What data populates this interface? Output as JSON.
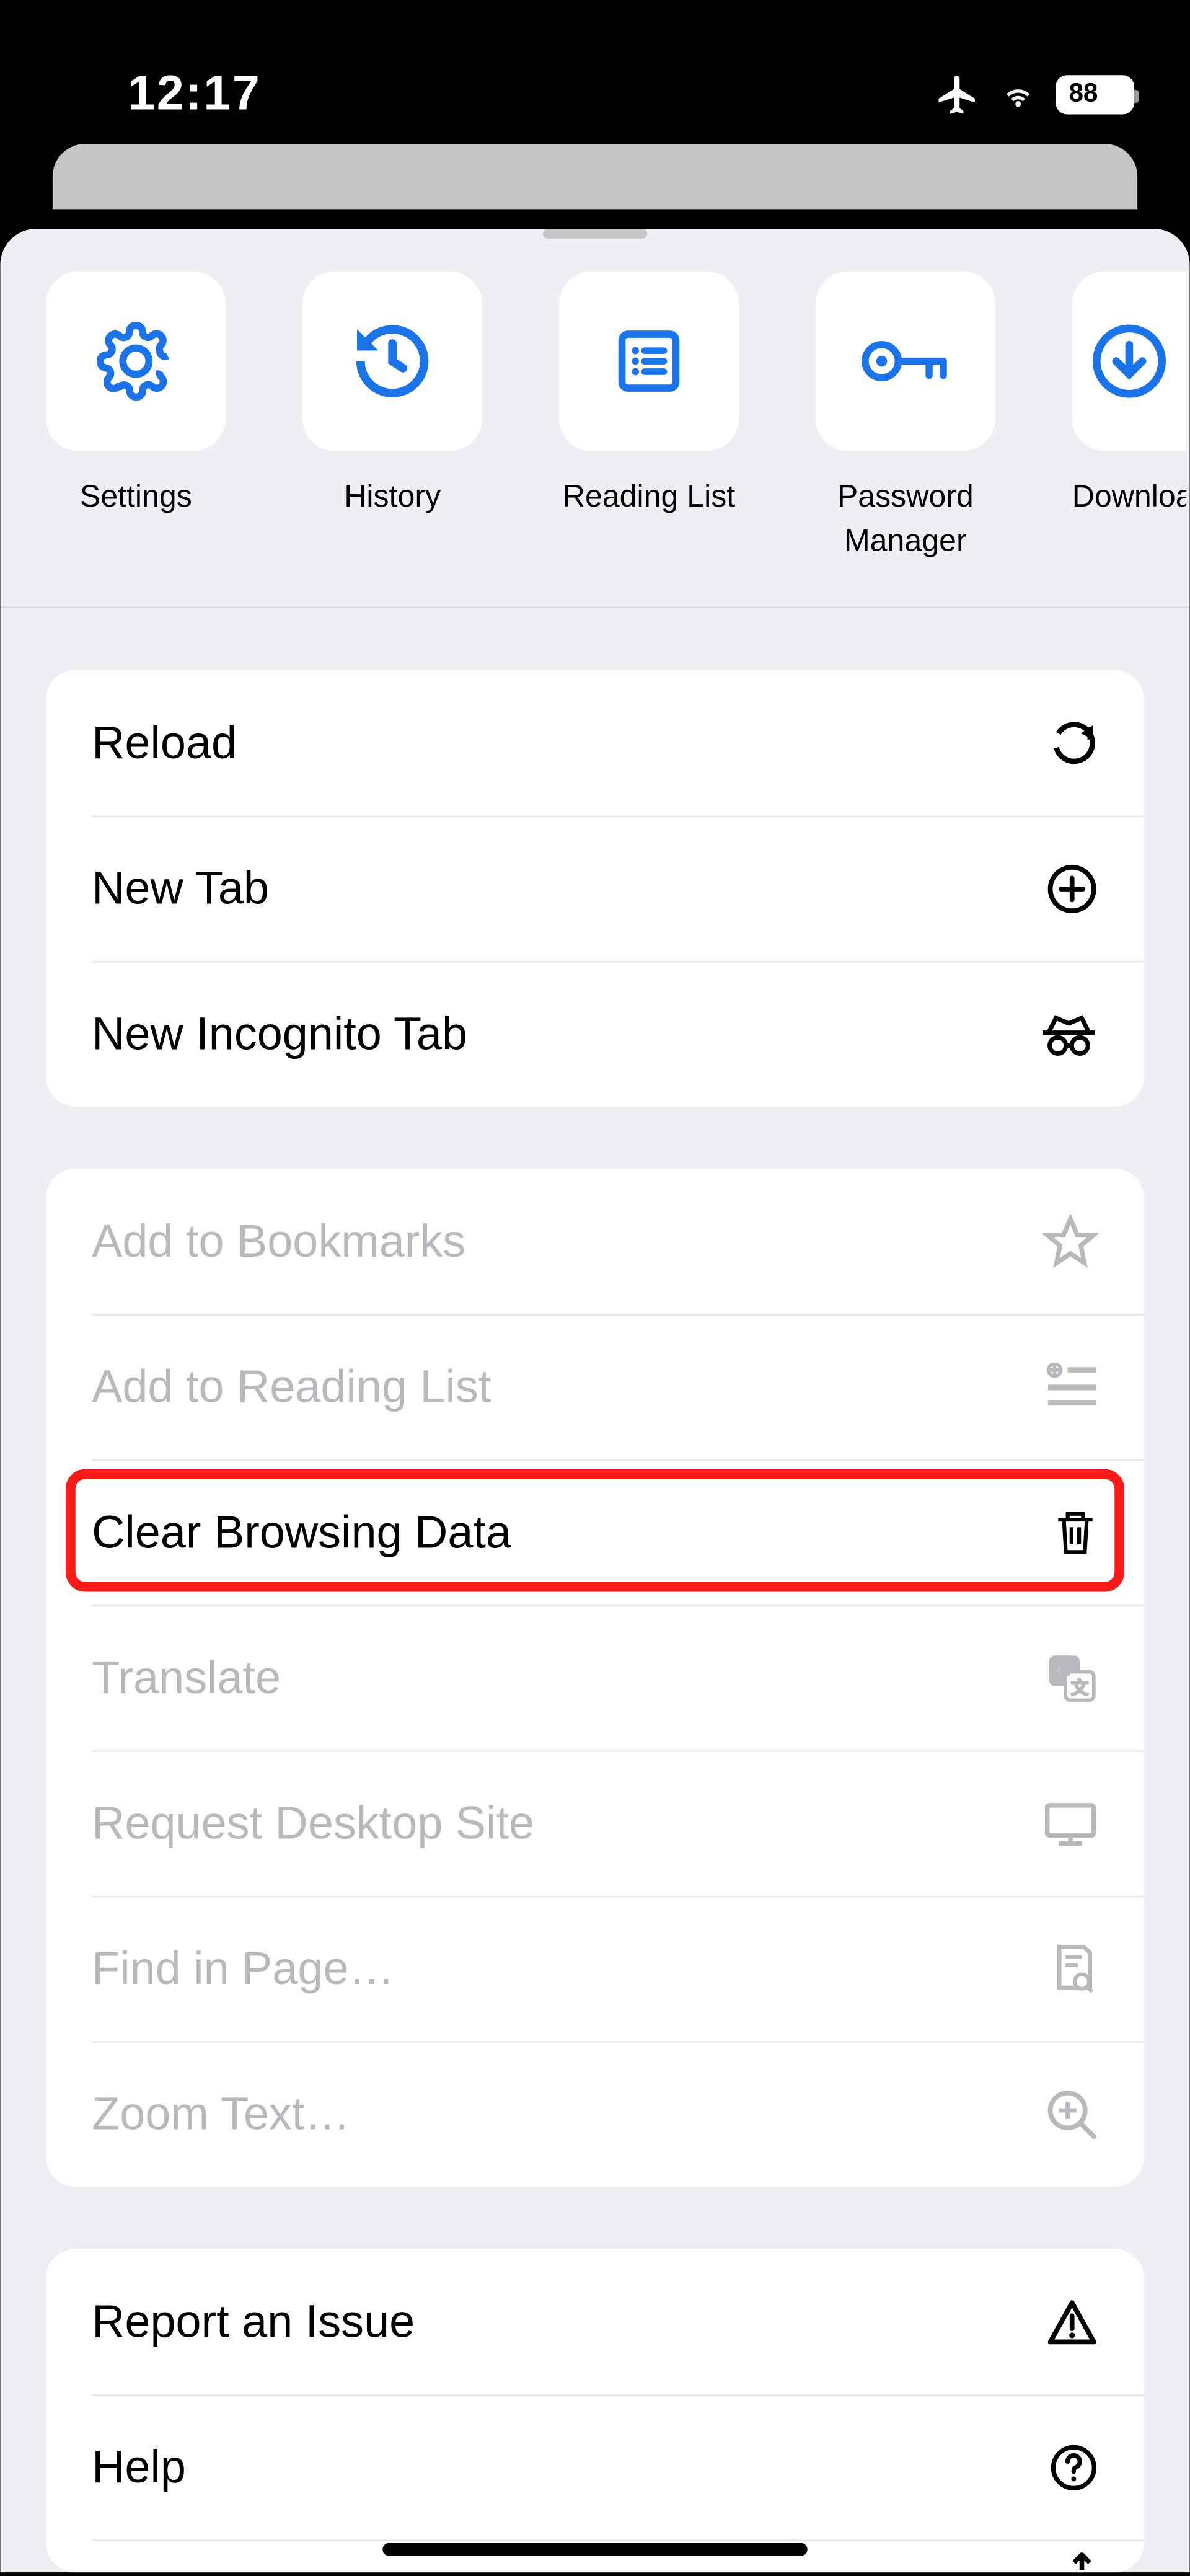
{
  "status": {
    "time": "12:17",
    "battery": "88"
  },
  "quick": [
    {
      "label": "Settings"
    },
    {
      "label": "History"
    },
    {
      "label": "Reading List"
    },
    {
      "label": "Password\nManager"
    },
    {
      "label": "Downloads"
    }
  ],
  "group1": [
    {
      "label": "Reload"
    },
    {
      "label": "New Tab"
    },
    {
      "label": "New Incognito Tab"
    }
  ],
  "group2": [
    {
      "label": "Add to Bookmarks",
      "disabled": true
    },
    {
      "label": "Add to Reading List",
      "disabled": true
    },
    {
      "label": "Clear Browsing Data",
      "highlighted": true
    },
    {
      "label": "Translate",
      "disabled": true
    },
    {
      "label": "Request Desktop Site",
      "disabled": true
    },
    {
      "label": "Find in Page…",
      "disabled": true
    },
    {
      "label": "Zoom Text…",
      "disabled": true
    }
  ],
  "group3": [
    {
      "label": "Report an Issue"
    },
    {
      "label": "Help"
    }
  ]
}
